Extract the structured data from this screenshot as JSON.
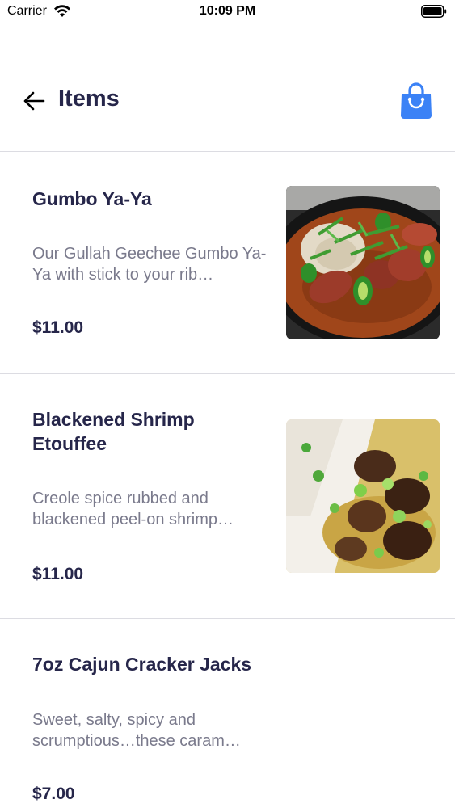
{
  "status_bar": {
    "carrier": "Carrier",
    "time": "10:09 PM"
  },
  "header": {
    "title": "Items",
    "back_icon": "arrow-left-icon",
    "cart_icon": "shopping-bag-icon"
  },
  "colors": {
    "accent": "#3b82f6",
    "text_primary": "#26264a",
    "text_secondary": "#7a7a8c",
    "divider": "#dcdce2"
  },
  "items": [
    {
      "name": "Gumbo Ya-Ya",
      "description": "Our Gullah Geechee Gumbo Ya-Ya with stick to your rib…",
      "price": "$11.00"
    },
    {
      "name": "Blackened Shrimp Etouffee",
      "description": "Creole spice rubbed and blackened peel-on shrimp…",
      "price": "$11.00"
    },
    {
      "name": "7oz Cajun Cracker Jacks",
      "description": "Sweet, salty, spicy and scrumptious…these caram…",
      "price": "$7.00"
    }
  ]
}
